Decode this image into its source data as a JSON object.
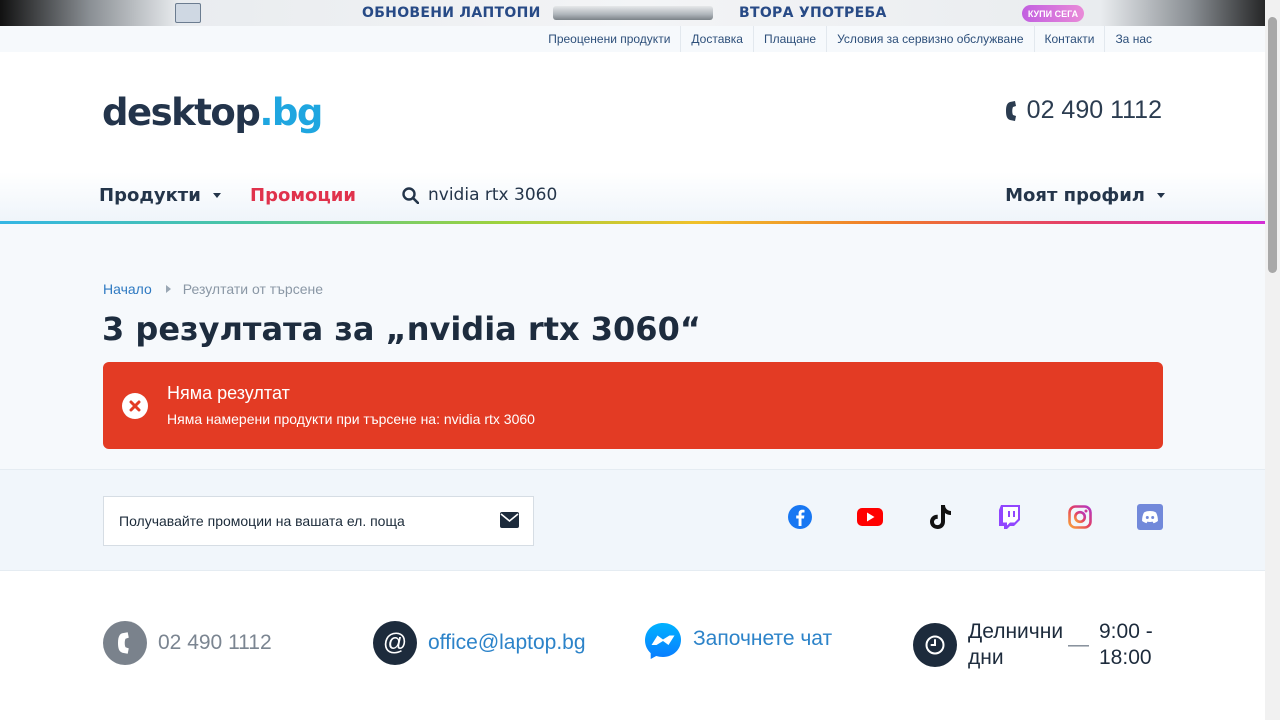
{
  "banner": {
    "left_text": "ОБНОВЕНИ ЛАПТОПИ",
    "right_text": "ВТОРА УПОТРЕБА",
    "button": "КУПИ СЕГА"
  },
  "toplinks": [
    "Преоценени продукти",
    "Доставка",
    "Плащане",
    "Условия за сервизно обслужване",
    "Контакти",
    "За нас"
  ],
  "header": {
    "logo_main": "desktop",
    "logo_tld": ".bg",
    "phone": "02 490 1112"
  },
  "nav": {
    "products": "Продукти",
    "promotions": "Промоции",
    "search_value": "nvidia rtx 3060",
    "profile": "Моят профил"
  },
  "breadcrumb": {
    "home": "Начало",
    "current": "Резултати от търсене"
  },
  "page_title": "3 резултата за „nvidia rtx 3060“",
  "alert": {
    "title": "Няма резултат",
    "message": "Няма намерени продукти при търсене на: nvidia rtx 3060"
  },
  "newsletter": {
    "placeholder": "Получавайте промоции на вашата ел. поща"
  },
  "socials": [
    "facebook-icon",
    "youtube-icon",
    "tiktok-icon",
    "twitch-icon",
    "instagram-icon",
    "discord-icon"
  ],
  "contacts": {
    "phone": "02 490 1112",
    "email": "office@laptop.bg",
    "chat": "Започнете чат",
    "hours_days": "Делнични дни",
    "hours_dash": "—",
    "hours_time": "9:00 - 18:00"
  },
  "colors": {
    "alert": "#e33b24",
    "promo": "#e0324c",
    "link": "#2c83c9",
    "dark": "#1d2b3c"
  }
}
